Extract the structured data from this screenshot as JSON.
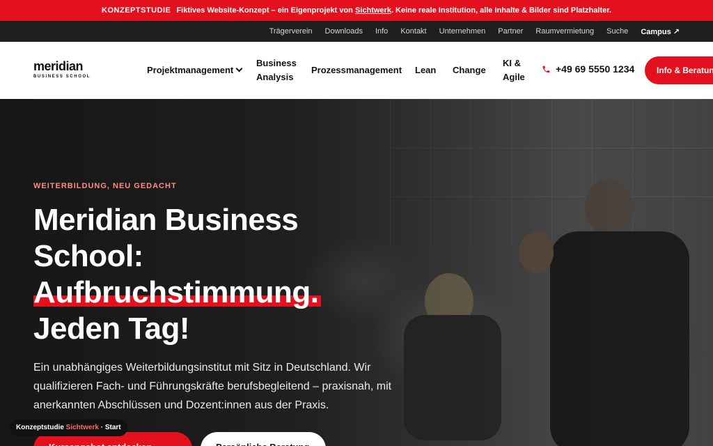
{
  "concept_bar": {
    "tag": "KONZEPTSTUDIE",
    "text_before": "Fiktives Website-Konzept – ein Eigenprojekt von",
    "link": "Sichtwerk",
    "text_after": ". Keine reale Institution, alle Inhalte & Bilder sind Platzhalter."
  },
  "util_nav": [
    "Trägerverein",
    "Downloads",
    "Info",
    "Kontakt",
    "Unternehmen",
    "Partner",
    "Raumvermietung",
    "Suche"
  ],
  "util_campus": "Campus ↗",
  "logo": {
    "word": "meridian",
    "sub": "BUSINESS SCHOOL"
  },
  "main_nav": {
    "projektmanagement": "Projektmanagement",
    "business_analysis_1": "Business",
    "business_analysis_2": "Analysis",
    "prozessmanagement": "Prozessmanagement",
    "lean": "Lean",
    "change": "Change",
    "ki_agile_1": "KI &",
    "ki_agile_2": "Agile"
  },
  "phone": "+49 69 5550 1234",
  "cta": "Info & Beratung",
  "hero": {
    "eyebrow": "WEITERBILDUNG, NEU GEDACHT",
    "headline_1": "Meridian Business",
    "headline_2": "School:",
    "headline_3": "Aufbruchstimmung.",
    "headline_4": "Jeden Tag!",
    "text": "Ein unabhängiges Weiterbildungsinstitut mit Sitz in Deutschland. Wir qualifizieren Fach- und Führungskräfte berufsbegleitend – praxisnah, mit anerkannten Abschlüssen und Dozent:innen aus der Praxis.",
    "btn_primary": "Kursangebot entdecken",
    "btn_secondary": "Persönliche Beratung"
  },
  "breadcrumb": {
    "label": "Konzeptstudie",
    "brand": "Sichtwerk",
    "sep": "·",
    "page": "Start"
  },
  "colors": {
    "accent": "#e3111d",
    "dark": "#1e1e1e"
  }
}
